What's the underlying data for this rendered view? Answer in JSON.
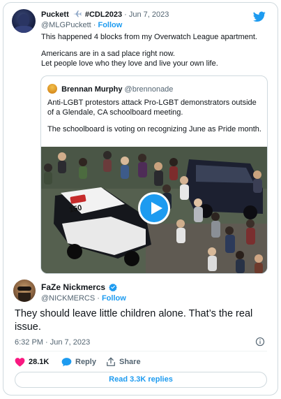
{
  "parent_tweet": {
    "author_name": "Puckett",
    "author_tag": "#CDL2023",
    "date": "· Jun 7, 2023",
    "handle": "@MLGPuckett",
    "separator": " · ",
    "follow_label": "Follow",
    "text_lines": [
      "This happened 4 blocks from my Overwatch League apartment.",
      "Americans are in a sad place right now.",
      "Let people love who they love and live your own life."
    ]
  },
  "quoted_tweet": {
    "author_name": "Brennan Murphy",
    "handle": "@brennonade",
    "text_lines": [
      "Anti-LGBT protestors attack Pro-LGBT demonstrators outside of a Glendale, CA schoolboard meeting.",
      "The schoolboard is voting on recognizing June as Pride month."
    ],
    "video_overlay": "150"
  },
  "reply_tweet": {
    "author_name": "FaZe Nickmercs",
    "handle": "@NICKMERCS",
    "separator": " · ",
    "follow_label": "Follow",
    "text": "They should leave little children alone. That’s the real issue.",
    "timestamp": "6:32 PM · Jun 7, 2023"
  },
  "actions": {
    "like_count": "28.1K",
    "reply_label": "Reply",
    "share_label": "Share",
    "read_replies_label": "Read 3.3K replies"
  },
  "colors": {
    "accent": "#1d9bf0",
    "like": "#f91880",
    "text": "#0f1419",
    "muted": "#536471",
    "border": "#cfd9de"
  },
  "icons": {
    "twitter": "twitter-bird-icon",
    "plane": "airplane-icon",
    "verified": "verified-badge-icon",
    "play": "play-icon",
    "info": "info-icon",
    "like": "heart-icon",
    "reply": "reply-bubble-icon",
    "share": "share-icon"
  }
}
